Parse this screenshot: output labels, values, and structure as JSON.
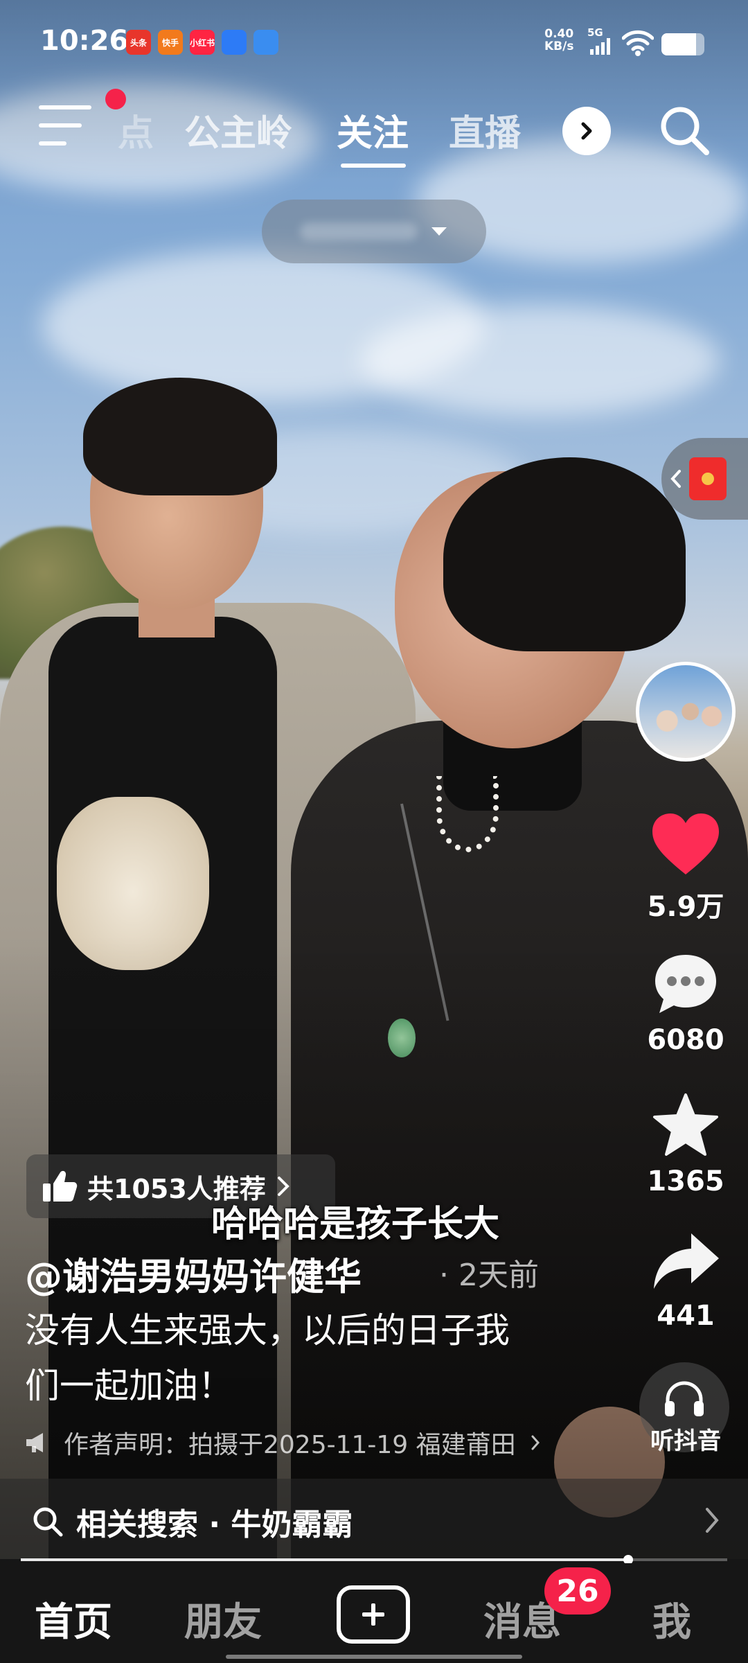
{
  "status_bar": {
    "time": "10:26",
    "notification_apps": [
      {
        "label": "头条",
        "color": "#e8352b"
      },
      {
        "label": "快手",
        "color": "#f27a1c"
      },
      {
        "label": "小红书",
        "color": "#ff2442"
      },
      {
        "label": "",
        "color": "#2d7bf6"
      },
      {
        "label": "",
        "color": "#3a8df0"
      }
    ],
    "net_speed_value": "0.40",
    "net_speed_unit": "KB/s",
    "network": "5G",
    "battery_level": 0.8
  },
  "top_nav": {
    "partial_tab": "点",
    "tabs": [
      "公主岭",
      "关注",
      "直播"
    ],
    "active_tab": "关注"
  },
  "right_rail": {
    "likes": "5.9万",
    "comments": "6080",
    "favorites": "1365",
    "shares": "441",
    "listen_label": "听抖音",
    "like_color": "#fe2c55"
  },
  "video": {
    "recommend_text": "共1053人推荐",
    "subtitle": "哈哈哈是孩子长大",
    "author": "@谢浩男妈妈许健华",
    "posted": "· 2天前",
    "caption": "没有人生来强大，以后的日子我们一起加油！",
    "declaration": "作者声明：拍摄于2025-11-19 福建莆田",
    "related_search": "相关搜索 · 牛奶霸霸",
    "progress": 0.86
  },
  "tab_bar": {
    "home": "首页",
    "friends": "朋友",
    "messages": "消息",
    "messages_badge": "26",
    "me": "我"
  }
}
